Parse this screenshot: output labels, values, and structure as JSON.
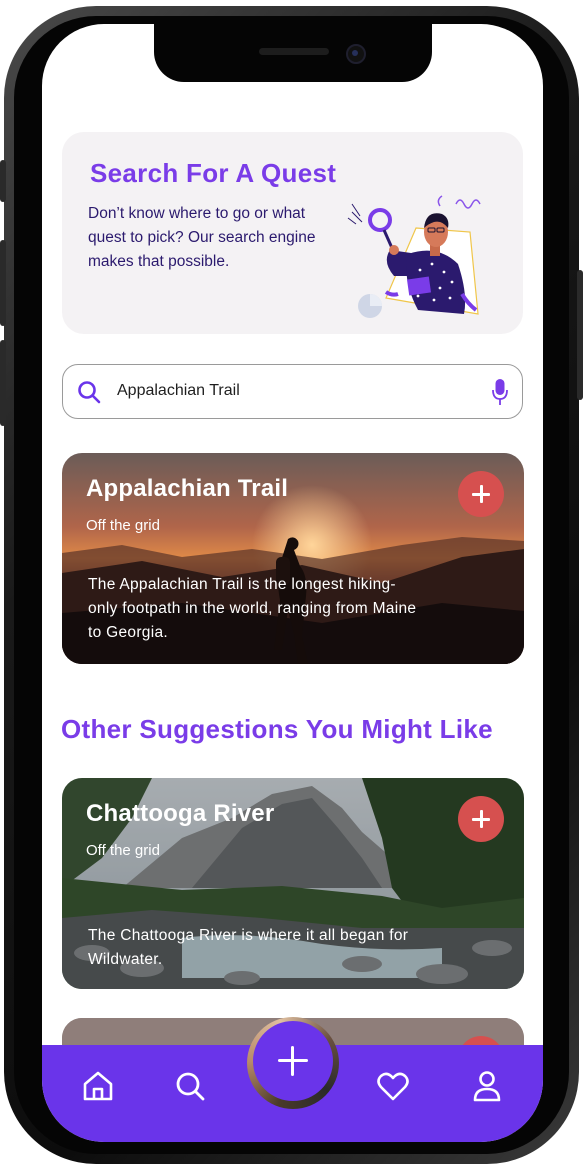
{
  "hero": {
    "title": "Search For A Quest",
    "description": "Don’t know where to go or what quest to pick? Our search engine makes that possible."
  },
  "search": {
    "value": "Appalachian Trail",
    "placeholder": "Search"
  },
  "featured": {
    "title": "Appalachian Trail",
    "subtitle": "Off the grid",
    "description": "The Appalachian Trail is the longest hiking-only footpath in the world, ranging from Maine to Georgia."
  },
  "suggestions": {
    "heading": "Other Suggestions You Might Like",
    "items": [
      {
        "title": "Chattooga River",
        "subtitle": "Off the grid",
        "description": "The Chattooga River is where it all began for Wildwater."
      }
    ]
  },
  "nav": {
    "items": [
      {
        "icon": "home-icon"
      },
      {
        "icon": "search-icon"
      },
      {
        "icon": "plus-icon"
      },
      {
        "icon": "heart-icon"
      },
      {
        "icon": "profile-icon"
      }
    ]
  },
  "colors": {
    "accent": "#7a3ce8",
    "nav": "#6a34ea",
    "add": "#d6504f",
    "hero_bg": "#f4f2f4",
    "hero_text": "#2b1a6e"
  }
}
